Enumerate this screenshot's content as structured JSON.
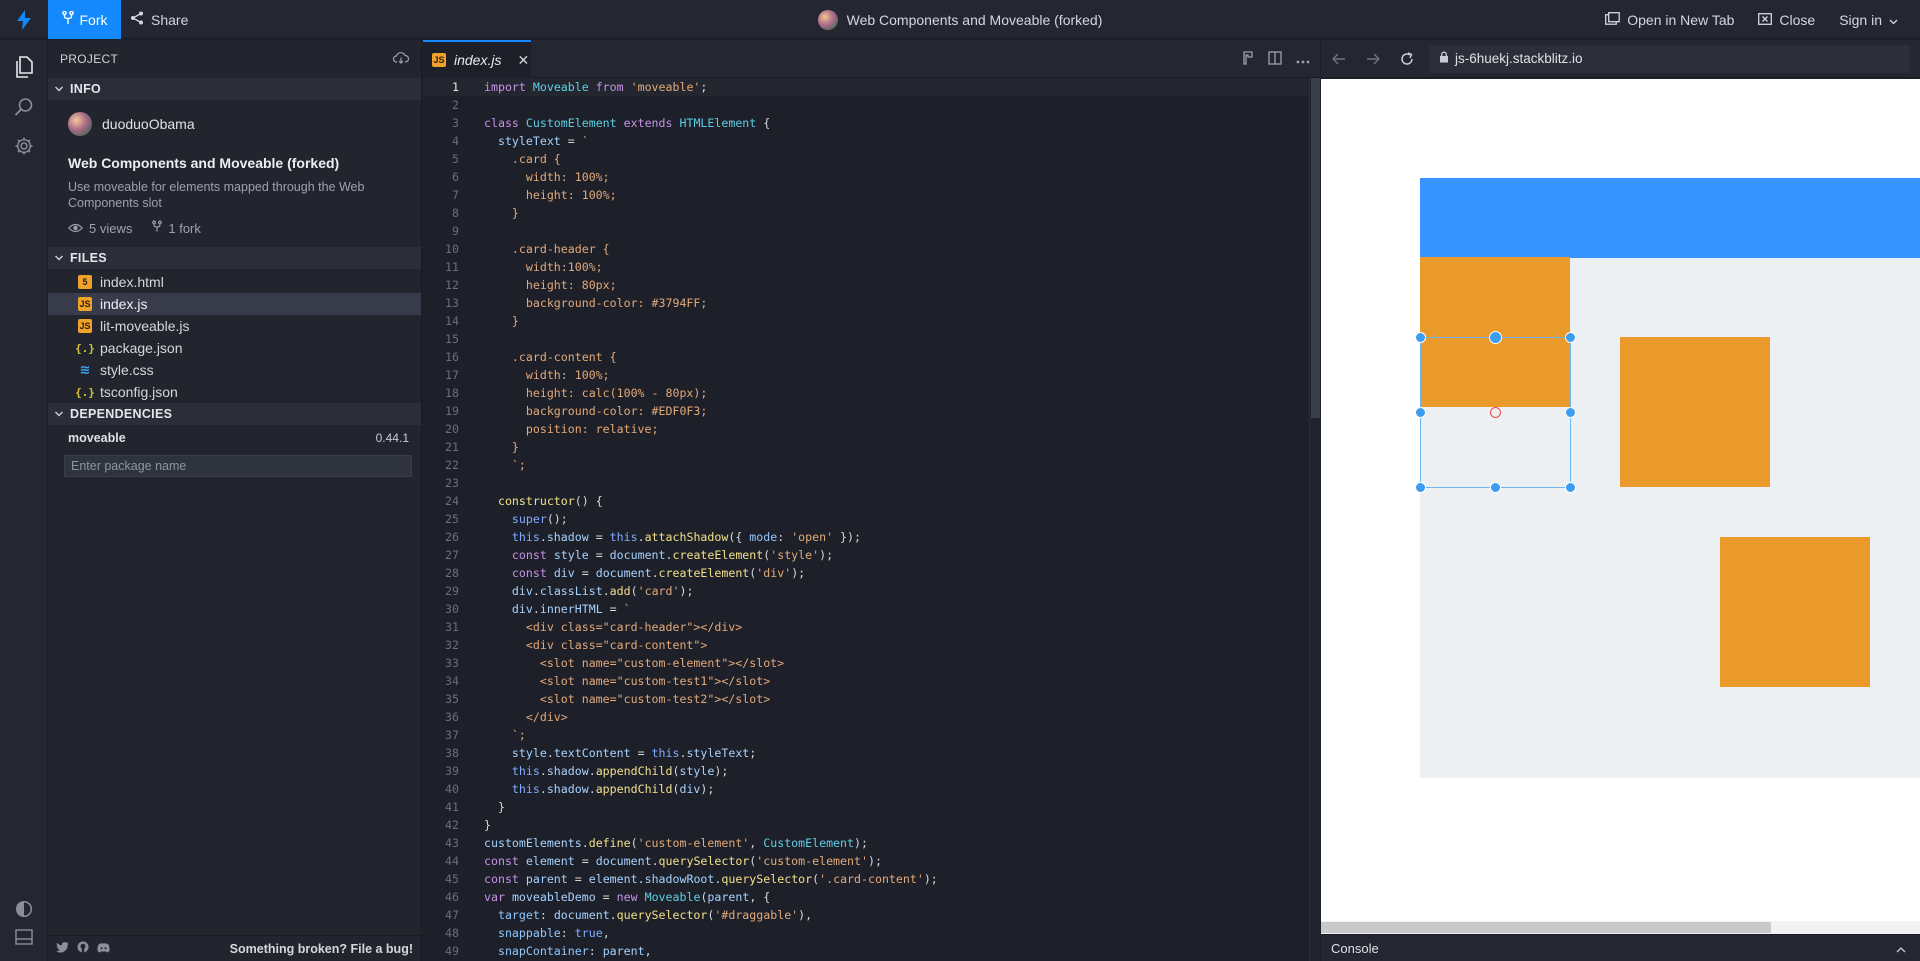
{
  "topbar": {
    "fork_label": "Fork",
    "share_label": "Share",
    "title": "Web Components and Moveable (forked)",
    "open_new_tab_label": "Open in New Tab",
    "close_label": "Close",
    "sign_in_label": "Sign in"
  },
  "sidebar": {
    "project_label": "PROJECT",
    "info_label": "INFO",
    "username": "duoduoObama",
    "project_title": "Web Components and Moveable (forked)",
    "project_description": "Use moveable for elements mapped through the Web Components slot",
    "views": "5 views",
    "forks": "1 fork",
    "files_label": "FILES",
    "files": [
      {
        "name": "index.html",
        "type": "html"
      },
      {
        "name": "index.js",
        "type": "js",
        "active": true
      },
      {
        "name": "lit-moveable.js",
        "type": "js"
      },
      {
        "name": "package.json",
        "type": "json"
      },
      {
        "name": "style.css",
        "type": "css"
      },
      {
        "name": "tsconfig.json",
        "type": "json"
      }
    ],
    "dependencies_label": "DEPENDENCIES",
    "dependency_name": "moveable",
    "dependency_version": "0.44.1",
    "package_placeholder": "Enter package name",
    "bug_link": "Something broken? File a bug!"
  },
  "editor": {
    "tab_name": "index.js",
    "current_line": 1,
    "lines": [
      "import Moveable from 'moveable';",
      "",
      "class CustomElement extends HTMLElement {",
      "  styleText = `",
      "    .card {",
      "      width: 100%;",
      "      height: 100%;",
      "    }",
      "",
      "    .card-header {",
      "      width:100%;",
      "      height: 80px;",
      "      background-color: #3794FF;",
      "    }",
      "",
      "    .card-content {",
      "      width: 100%;",
      "      height: calc(100% - 80px);",
      "      background-color: #EDF0F3;",
      "      position: relative;",
      "    }",
      "    `;",
      "",
      "  constructor() {",
      "    super();",
      "    this.shadow = this.attachShadow({ mode: 'open' });",
      "    const style = document.createElement('style');",
      "    const div = document.createElement('div');",
      "    div.classList.add('card');",
      "    div.innerHTML = `",
      "      <div class=\"card-header\"></div>",
      "      <div class=\"card-content\">",
      "        <slot name=\"custom-element\"></slot>",
      "        <slot name=\"custom-test1\"></slot>",
      "        <slot name=\"custom-test2\"></slot>",
      "      </div>",
      "    `;",
      "    style.textContent = this.styleText;",
      "    this.shadow.appendChild(style);",
      "    this.shadow.appendChild(div);",
      "  }",
      "}",
      "customElements.define('custom-element', CustomElement);",
      "const element = document.querySelector('custom-element');",
      "const parent = element.shadowRoot.querySelector('.card-content');",
      "var moveableDemo = new Moveable(parent, {",
      "  target: document.querySelector('#draggable'),",
      "  snappable: true,",
      "  snapContainer: parent,"
    ]
  },
  "preview": {
    "url": "js-6huekj.stackblitz.io",
    "console_label": "Console"
  },
  "colors": {
    "accent": "#1389fd",
    "card_header": "#3794FF",
    "card_content": "#EDF0F3",
    "box": "#ea9a2b",
    "handle": "#3b9cf0"
  }
}
